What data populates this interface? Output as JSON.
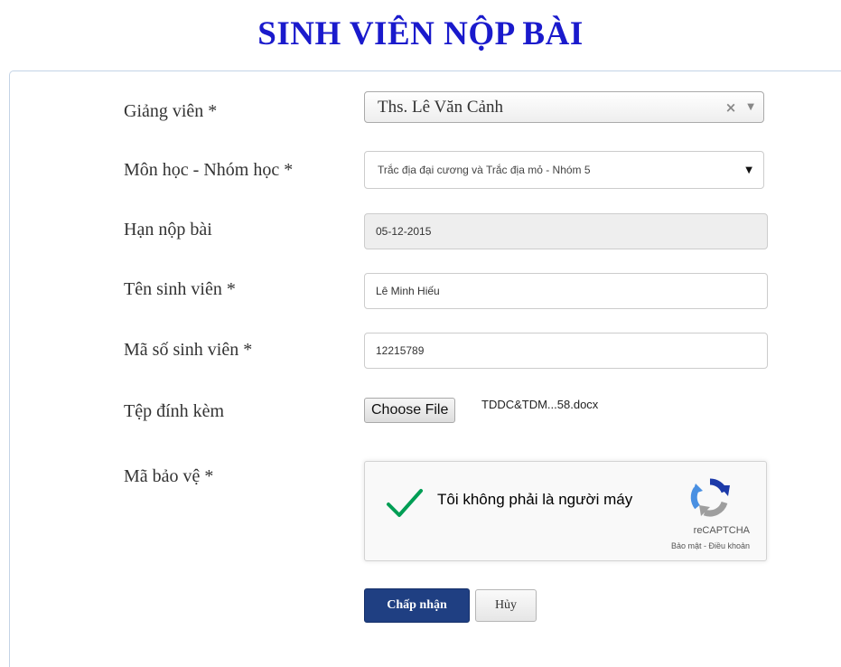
{
  "page": {
    "title": "SINH VIÊN NỘP BÀI"
  },
  "form": {
    "lecturer": {
      "label": "Giảng viên *",
      "value": "Ths. Lê Văn Cảnh",
      "clear": "×",
      "caret": "▼"
    },
    "course_group": {
      "label": "Môn học - Nhóm học *",
      "value": "Trắc địa đại cương và Trắc địa mỏ - Nhóm 5",
      "caret": "▼"
    },
    "deadline": {
      "label": "Hạn nộp bài",
      "value": "05-12-2015"
    },
    "student_name": {
      "label": "Tên sinh viên *",
      "value": "Lê Minh Hiếu"
    },
    "student_id": {
      "label": "Mã số sinh viên *",
      "value": "12215789"
    },
    "attachment": {
      "label": "Tệp đính kèm",
      "button_label": "Choose File",
      "file_name": "TDDC&TDM...58.docx"
    },
    "captcha": {
      "label": "Mã bảo vệ *",
      "checkbox_label": "Tôi không phải là người máy",
      "brand": "reCAPTCHA",
      "terms": "Bảo mật - Điều khoản",
      "checked": true
    },
    "buttons": {
      "submit": "Chấp nhận",
      "cancel": "Hủy"
    }
  },
  "colors": {
    "title": "#1a1acc",
    "primary_button": "#1f3f82",
    "check_mark": "#009e55"
  },
  "icons": [
    "check-icon",
    "recaptcha-logo-icon",
    "clear-icon",
    "caret-down-icon"
  ]
}
